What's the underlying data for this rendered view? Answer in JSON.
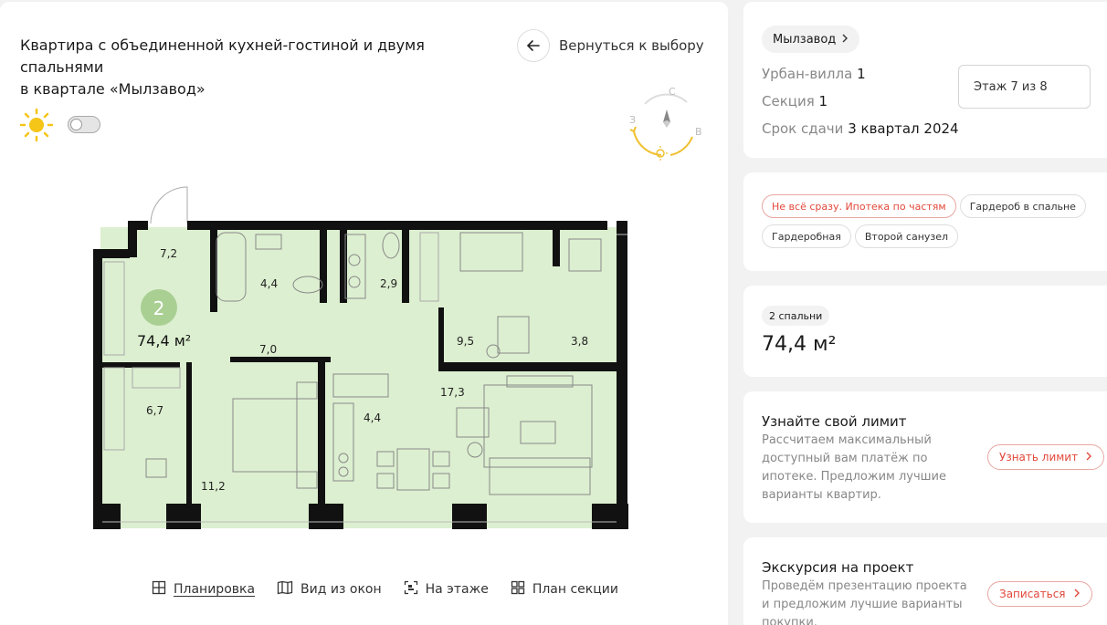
{
  "apartment": {
    "title_line1": "Квартира с объединенной кухней-гостиной и двумя спальнями",
    "title_line2": "в квартале «Мылзавод»",
    "back_label": "Вернуться к выбору",
    "rooms_count": "2",
    "total_area": "74,4 м²"
  },
  "compass": {
    "north": "С",
    "west": "З",
    "east": "В"
  },
  "floorplan": {
    "rooms": [
      {
        "label": "7,2"
      },
      {
        "label": "4,4"
      },
      {
        "label": "2,9"
      },
      {
        "label": "9,5"
      },
      {
        "label": "3,8"
      },
      {
        "label": "7,0"
      },
      {
        "label": "6,7"
      },
      {
        "label": "4,4"
      },
      {
        "label": "17,3"
      },
      {
        "label": "11,2"
      }
    ]
  },
  "view_tabs": [
    {
      "label": "Планировка",
      "icon": "layout-icon",
      "active": true
    },
    {
      "label": "Вид из окон",
      "icon": "window-view-icon",
      "active": false
    },
    {
      "label": "На этаже",
      "icon": "floor-icon",
      "active": false
    },
    {
      "label": "План секции",
      "icon": "section-plan-icon",
      "active": false
    }
  ],
  "info": {
    "project": "Мылзавод",
    "building_label": "Урбан-вилла",
    "building_value": "1",
    "section_label": "Секция",
    "section_value": "1",
    "deadline_label": "Срок сдачи",
    "deadline_value": "3 квартал 2024",
    "floor": "Этаж 7 из 8"
  },
  "tags": [
    "Не всё сразу. Ипотека по частям",
    "Гардероб в спальне",
    "Гардеробная",
    "Второй санузел"
  ],
  "bedrooms_chip": "2 спальни",
  "area_card": "74,4 м²",
  "limit_card": {
    "title": "Узнайте свой лимит",
    "text": "Рассчитаем максимальный доступный вам платёж по ипотеке. Предложим лучшие варианты квартир.",
    "button": "Узнать лимит"
  },
  "tour_card": {
    "title": "Экскурсия на проект",
    "text": "Проведём презентацию проекта и предложим лучшие варианты покупки.",
    "button": "Записаться"
  },
  "colors": {
    "accent": "#e2483a",
    "room_fill": "#dcefd0",
    "sun": "#f5c518",
    "badge": "#a9cf93"
  }
}
